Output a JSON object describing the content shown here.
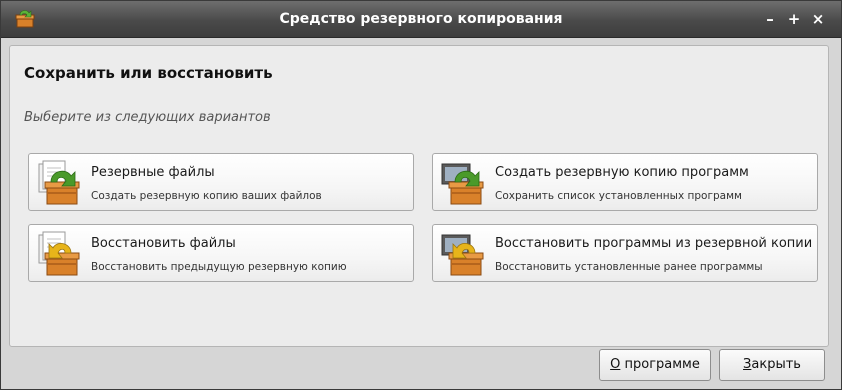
{
  "window": {
    "title": "Средство резервного копирования",
    "minimize_label": "–",
    "maximize_label": "+",
    "close_label": "×"
  },
  "main": {
    "heading": "Сохранить или восстановить",
    "subheading": "Выберите из следующих вариантов",
    "options": [
      {
        "title": "Резервные файлы",
        "description": "Создать резервную копию ваших файлов",
        "icon": "backup-files-icon"
      },
      {
        "title": "Создать резервную копию программ",
        "description": "Сохранить список установленных программ",
        "icon": "backup-programs-icon"
      },
      {
        "title": "Восстановить файлы",
        "description": "Восстановить предыдущую резервную копию",
        "icon": "restore-files-icon"
      },
      {
        "title": "Восстановить программы из резервной копии",
        "description": "Восстановить установленные ранее программы",
        "icon": "restore-programs-icon"
      }
    ]
  },
  "footer": {
    "about_mnemonic": "О",
    "about_rest": " программе",
    "close_mnemonic": "З",
    "close_rest": "акрыть"
  },
  "colors": {
    "titlebar": "#4a4a4a",
    "arrow_backup": "#4a9a2a",
    "arrow_restore": "#e7b41a",
    "box": "#d9812a"
  }
}
